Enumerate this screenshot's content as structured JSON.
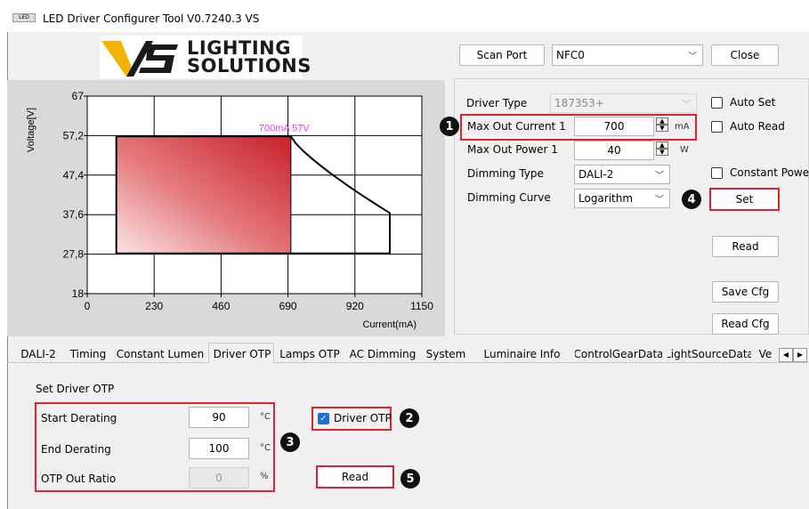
{
  "window": {
    "title": "LED Driver Configurer Tool V0.7240.3  VS",
    "app_icon": "app-icon"
  },
  "logo": {
    "line1": "LIGHTING",
    "line2": "SOLUTIONS"
  },
  "header": {
    "scan_port_label": "Scan Port",
    "port_value": "NFC0",
    "close_label": "Close"
  },
  "chart_data": {
    "type": "area",
    "ylabel": "Voltage[V]",
    "xlabel": "Current(mA)",
    "x_ticks": [
      "0",
      "230",
      "460",
      "690",
      "920",
      "1150"
    ],
    "y_ticks": [
      "67",
      "57,2",
      "47,4",
      "37,6",
      "27,8",
      "18"
    ],
    "xlim": [
      0,
      1150
    ],
    "ylim": [
      18,
      67
    ],
    "annotation": "700mA 57V",
    "operating_point": {
      "x": 700,
      "y": 57
    },
    "envelope": {
      "min_current": 100,
      "max_voltage": 57,
      "min_voltage": 28,
      "max_current": 1040,
      "current_at_corner": 1040,
      "voltage_at_corner": 38
    },
    "grid": true
  },
  "config": {
    "driver_type_label": "Driver Type",
    "driver_type_value": "187353+",
    "max_out_current_label": "Max Out Current 1",
    "max_out_current_value": "700",
    "max_out_current_unit": "mA",
    "max_out_power_label": "Max Out Power 1",
    "max_out_power_value": "40",
    "max_out_power_unit": "W",
    "dimming_type_label": "Dimming Type",
    "dimming_type_value": "DALI-2",
    "dimming_curve_label": "Dimming Curve",
    "dimming_curve_value": "Logarithm",
    "auto_set_label": "Auto Set",
    "auto_read_label": "Auto Read",
    "constant_power_label": "Constant Powe",
    "set_label": "Set",
    "read_label": "Read",
    "save_cfg_label": "Save Cfg",
    "read_cfg_label": "Read Cfg"
  },
  "tabs": [
    "DALI-2",
    "Timing",
    "Constant Lumen",
    "Driver OTP",
    "Lamps OTP",
    "AC Dimming",
    "System",
    "Luminaire Info",
    "ControlGearData",
    "LightSourceData",
    "Ve"
  ],
  "active_tab": "Driver OTP",
  "otp": {
    "section_title": "Set Driver OTP",
    "start_derating_label": "Start Derating",
    "start_derating_value": "90",
    "end_derating_label": "End Derating",
    "end_derating_value": "100",
    "otp_out_ratio_label": "OTP Out Ratio",
    "otp_out_ratio_value": "0",
    "temp_unit": "°C",
    "ratio_unit": "%",
    "driver_otp_label": "Driver OTP",
    "read_label": "Read"
  },
  "badges": [
    "1",
    "2",
    "3",
    "4",
    "5"
  ],
  "colors": {
    "highlight": "#e0202a",
    "area_dark": "#c8202a",
    "annotation": "#e040e0",
    "checkbox": "#1e6fd9"
  }
}
